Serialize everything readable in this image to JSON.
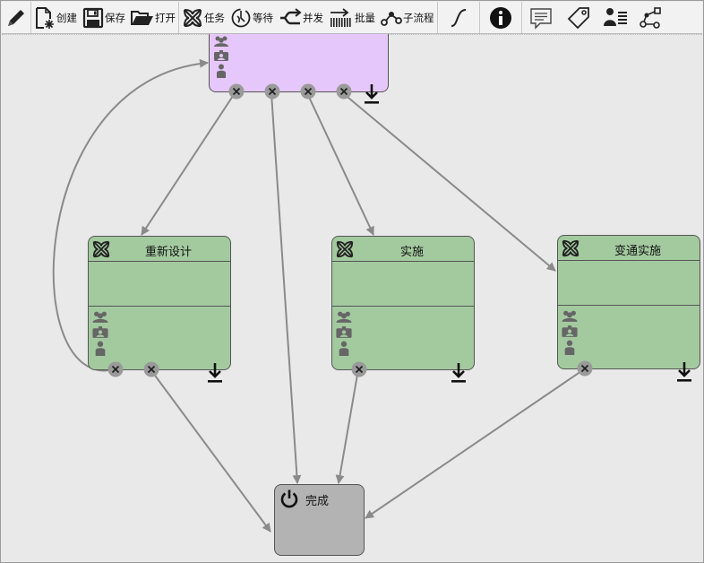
{
  "toolbar": {
    "edit": "",
    "create": "创建",
    "save": "保存",
    "open": "打开",
    "task": "任务",
    "wait": "等待",
    "merge": "并发",
    "batch": "批量",
    "subflow": "子流程"
  },
  "nodes": {
    "redesign": "重新设计",
    "implement": "实施",
    "alt_implement": "变通实施",
    "end": "完成"
  },
  "colors": {
    "task_fill": "#a3ca9f",
    "start_fill": "#e6c7fb",
    "end_fill": "#b3b3b3",
    "edge": "#8a8a8a"
  }
}
